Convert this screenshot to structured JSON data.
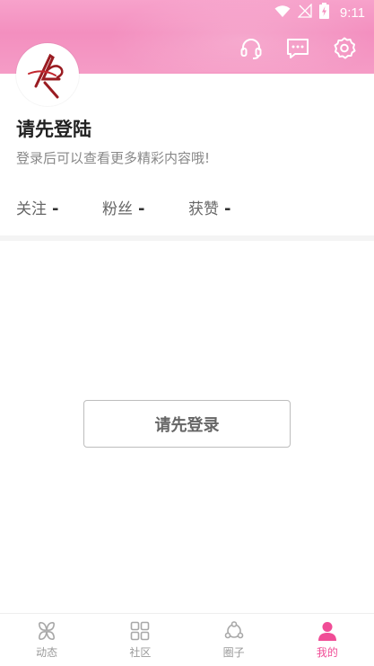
{
  "status_bar": {
    "time": "9:11"
  },
  "profile": {
    "title": "请先登陆",
    "subtitle": "登录后可以查看更多精彩内容哦!",
    "stats": [
      {
        "label": "关注",
        "value": "-"
      },
      {
        "label": "粉丝",
        "value": "-"
      },
      {
        "label": "获赞",
        "value": "-"
      }
    ]
  },
  "main": {
    "login_button": "请先登录"
  },
  "nav": {
    "items": [
      {
        "label": "动态",
        "icon": "flower-icon",
        "active": false
      },
      {
        "label": "社区",
        "icon": "grid-icon",
        "active": false
      },
      {
        "label": "圈子",
        "icon": "circles-icon",
        "active": false
      },
      {
        "label": "我的",
        "icon": "person-icon",
        "active": true
      }
    ]
  },
  "colors": {
    "accent": "#f04c96",
    "header": "#f595c3"
  }
}
